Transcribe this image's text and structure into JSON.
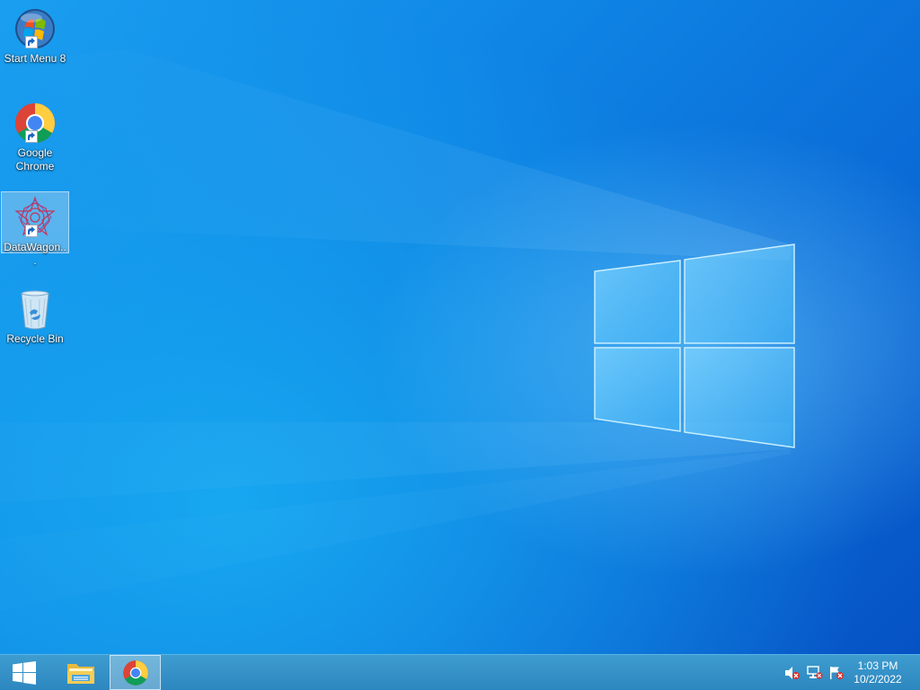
{
  "desktop": {
    "icons": [
      {
        "label": "Start Menu 8",
        "icon": "start-menu-8-icon"
      },
      {
        "label": "Google Chrome",
        "icon": "chrome-icon"
      },
      {
        "label": "DataWagon...",
        "icon": "datawagon-icon"
      },
      {
        "label": "Recycle Bin",
        "icon": "recycle-bin-icon"
      }
    ]
  },
  "taskbar": {
    "start_icon": "windows-start-icon",
    "pinned": [
      {
        "icon": "file-explorer-icon"
      },
      {
        "icon": "chrome-icon",
        "active": true
      }
    ],
    "tray": [
      "volume-muted-icon",
      "network-icon",
      "action-center-flag-icon"
    ],
    "clock": {
      "time": "1:03 PM",
      "date": "10/2/2022"
    }
  },
  "colors": {
    "wallpaper": "#0f86e6",
    "taskbar": "#3594c8",
    "selection": "#aad2f0"
  }
}
